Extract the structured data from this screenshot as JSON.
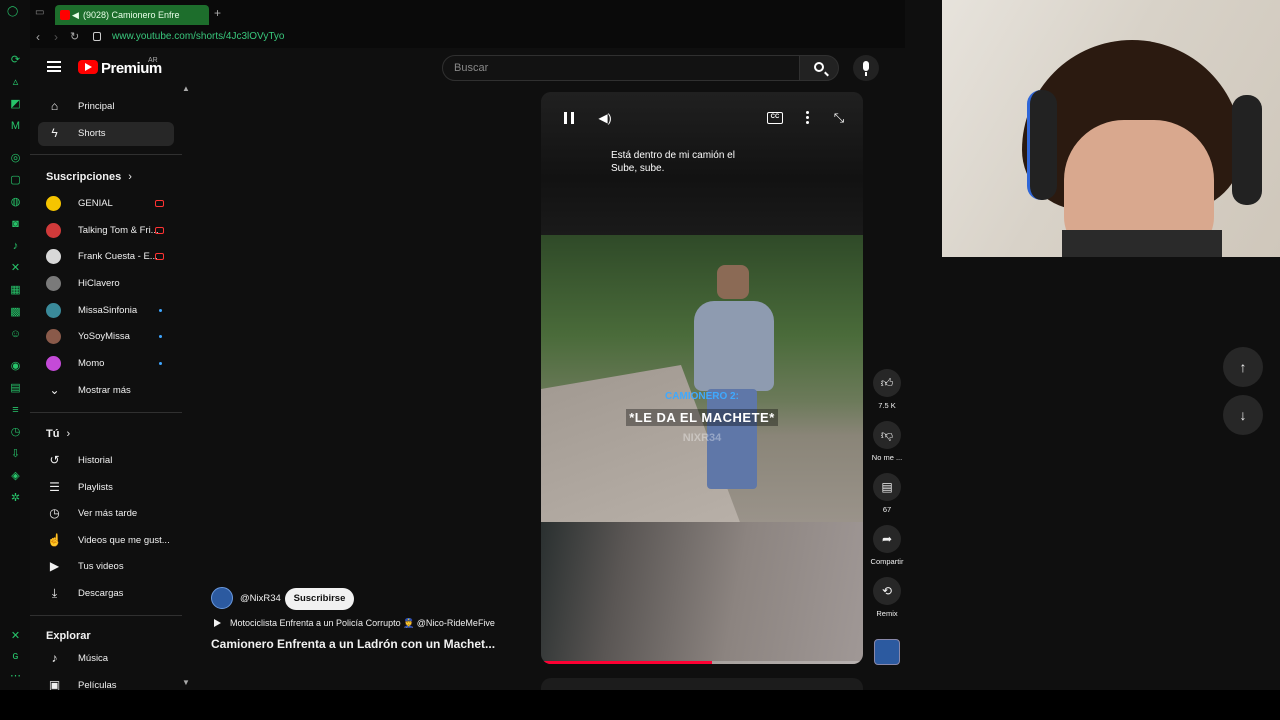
{
  "browser": {
    "tab_title": "(9028) Camionero Enfre",
    "url": "www.youtube.com/shorts/4Jc3lOVyTyo"
  },
  "header": {
    "logo_text": "Premium",
    "country_code": "AR",
    "search_placeholder": "Buscar"
  },
  "sidebar": {
    "main": [
      {
        "label": "Principal",
        "icon": "home-icon"
      },
      {
        "label": "Shorts",
        "icon": "shorts-icon",
        "active": true
      }
    ],
    "subscriptions_title": "Suscripciones",
    "subscriptions": [
      {
        "label": "GENIAL",
        "avatar_color": "#f5c400",
        "live": true
      },
      {
        "label": "Talking Tom & Fri...",
        "avatar_color": "#d03a3a",
        "live": true
      },
      {
        "label": "Frank Cuesta - E...",
        "avatar_color": "#d8d8d8",
        "live": true
      },
      {
        "label": "HiClavero",
        "avatar_color": "#7a7a7a"
      },
      {
        "label": "MissaSinfonia",
        "avatar_color": "#3a8a9a",
        "new": true
      },
      {
        "label": "YoSoyMissa",
        "avatar_color": "#8a5a4a",
        "new": true
      },
      {
        "label": "Momo",
        "avatar_color": "#c44ad8",
        "new": true
      }
    ],
    "show_more": "Mostrar más",
    "you_title": "Tú",
    "you": [
      {
        "label": "Historial",
        "icon": "history-icon"
      },
      {
        "label": "Playlists",
        "icon": "playlists-icon"
      },
      {
        "label": "Ver más tarde",
        "icon": "watch-later-icon"
      },
      {
        "label": "Videos que me gust...",
        "icon": "like-icon"
      },
      {
        "label": "Tus videos",
        "icon": "your-videos-icon"
      },
      {
        "label": "Descargas",
        "icon": "download-icon"
      }
    ],
    "explore_title": "Explorar",
    "explore": [
      {
        "label": "Música",
        "icon": "music-icon"
      },
      {
        "label": "Películas",
        "icon": "movies-icon"
      }
    ]
  },
  "short": {
    "channel": "@NixR34",
    "subscribe_label": "Suscribirse",
    "track": "Motociclista Enfrenta a un Policía Corrupto 👮 @Nico-RideMeFive",
    "title": "Camionero Enfrenta a un Ladrón con un Machet...",
    "caption_line1": "Está dentro de mi camión el",
    "caption_line2": "Sube, sube.",
    "overlay_speaker": "CAMIONERO 2:",
    "overlay_text": "*LE DA EL MACHETE*",
    "watermark": "NIXR34",
    "progress_fraction": 0.53
  },
  "actions": {
    "likes": "7.5 K",
    "dislike_label": "No me ...",
    "comments": "67",
    "share_label": "Compartir",
    "remix_label": "Remix"
  }
}
